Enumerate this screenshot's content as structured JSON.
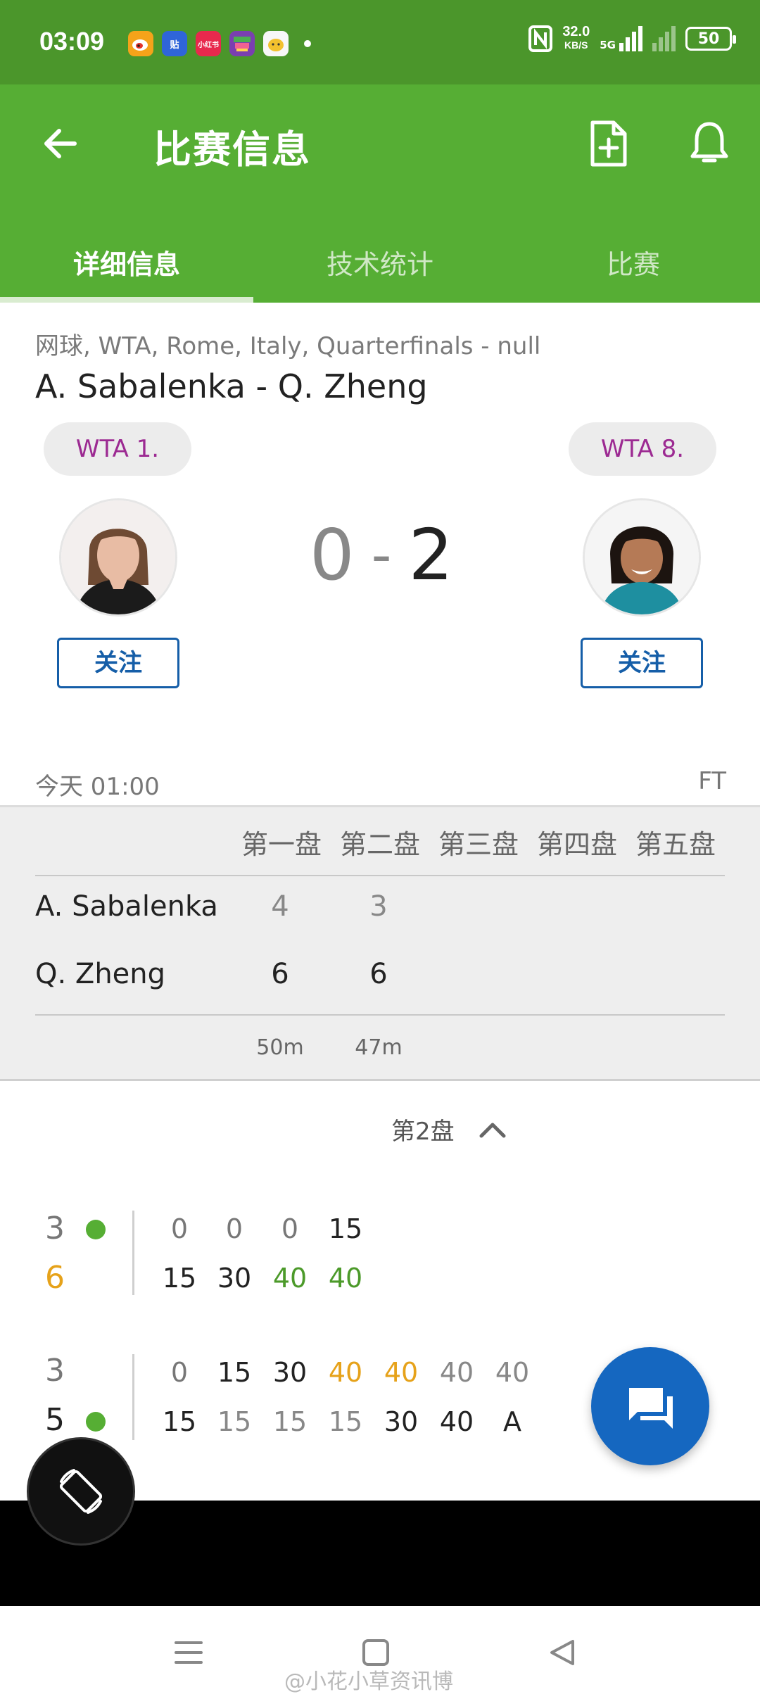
{
  "status_bar": {
    "time": "03:09",
    "app_icons": [
      {
        "icon": "weibo-icon",
        "label": "",
        "color": "#f5a31a"
      },
      {
        "icon": "tieba-icon",
        "label": "贴",
        "color": "#2f65d9"
      },
      {
        "icon": "xiaohongshu-icon",
        "label": "小红书",
        "color": "#e8294d"
      },
      {
        "icon": "app-icon",
        "label": "",
        "color": "#7a3fb0"
      },
      {
        "icon": "chat-icon",
        "label": "",
        "color": "#f2c12e"
      }
    ],
    "net_speed": "32.0",
    "net_unit": "KB/S",
    "network": "5G",
    "battery": "50"
  },
  "header": {
    "title": "比赛信息",
    "back_icon": "arrow-left-icon",
    "actions": [
      "add-document-icon",
      "bell-icon"
    ]
  },
  "tabs": [
    {
      "label": "详细信息",
      "active": true
    },
    {
      "label": "技术统计",
      "active": false
    },
    {
      "label": "比赛",
      "active": false
    }
  ],
  "match": {
    "meta": "网球, WTA, Rome, Italy, Quarterfinals - null",
    "title": "A. Sabalenka - Q. Zheng",
    "home": {
      "rank": "WTA 1.",
      "follow": "关注",
      "sets": "0"
    },
    "away": {
      "rank": "WTA 8.",
      "follow": "关注",
      "sets": "2"
    },
    "dash": "-",
    "date": "今天 01:00",
    "status": "FT"
  },
  "sets": {
    "headers": [
      "第一盘",
      "第二盘",
      "第三盘",
      "第四盘",
      "第五盘"
    ],
    "rows": [
      {
        "name": "A. Sabalenka",
        "scores": [
          "4",
          "3"
        ]
      },
      {
        "name": "Q. Zheng",
        "scores": [
          "6",
          "6"
        ]
      }
    ],
    "durations": [
      "50m",
      "47m"
    ]
  },
  "set_toggle": {
    "label": "第2盘",
    "icon": "chevron-up-icon"
  },
  "games": [
    {
      "top_score": "3",
      "bottom_score": "6",
      "server": "top",
      "top_points": [
        "0",
        "0",
        "0",
        "15"
      ],
      "bottom_points": [
        "15",
        "30",
        "40",
        "40"
      ]
    },
    {
      "top_score": "3",
      "bottom_score": "5",
      "server": "bottom",
      "top_points": [
        "0",
        "15",
        "30",
        "40",
        "40",
        "40",
        "40"
      ],
      "bottom_points": [
        "15",
        "15",
        "15",
        "15",
        "30",
        "40",
        "A"
      ]
    }
  ],
  "colors": {
    "status_bar": "#4b962b",
    "app_bar": "#56ae34",
    "accent_green": "#4c9a2a",
    "accent_orange": "#e6a21a",
    "rank_text": "#9c2a92",
    "follow_blue": "#155ea8",
    "fab_blue": "#1567c0"
  },
  "fab": {
    "icon": "chat-icon"
  },
  "rotate": {
    "icon": "screen-rotate-icon"
  },
  "nav": [
    "menu-icon",
    "home-square-icon",
    "back-triangle-icon"
  ],
  "watermark": "@小花小草资讯博"
}
